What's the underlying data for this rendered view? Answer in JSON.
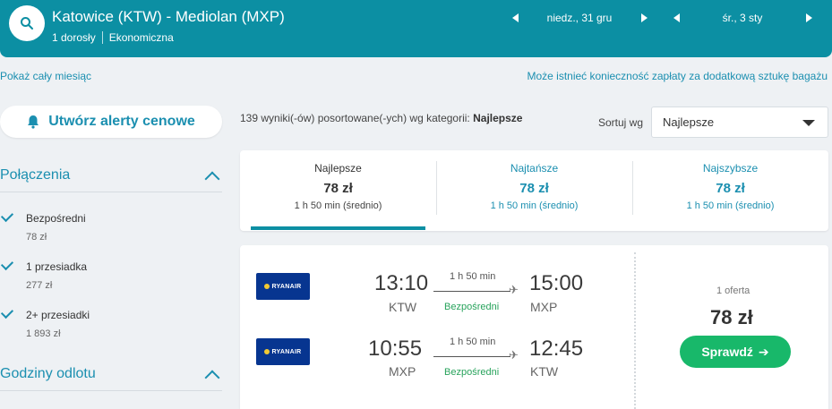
{
  "header": {
    "route": "Katowice (KTW) - Mediolan (MXP)",
    "passengers": "1 dorosły",
    "cabin": "Ekonomiczna",
    "depart_date": "niedz., 31 gru",
    "return_date": "śr., 3 sty"
  },
  "links": {
    "show_month": "Pokaż cały miesiąc",
    "baggage_notice": "Może istnieć konieczność zapłaty za dodatkową sztukę bagażu"
  },
  "sidebar": {
    "alert_button": "Utwórz alerty cenowe",
    "connections_title": "Połączenia",
    "filters": [
      {
        "label": "Bezpośredni",
        "price": "78 zł"
      },
      {
        "label": "1 przesiadka",
        "price": "277 zł"
      },
      {
        "label": "2+ przesiadki",
        "price": "1 893 zł"
      }
    ],
    "departure_title": "Godziny odlotu"
  },
  "results": {
    "count_text": "139 wyniki(-ów) posortowane(-ych) wg kategorii:",
    "count_category": "Najlepsze",
    "sort_label": "Sortuj wg",
    "sort_value": "Najlepsze"
  },
  "tabs": [
    {
      "name": "Najlepsze",
      "price": "78 zł",
      "duration": "1 h 50 min (średnio)"
    },
    {
      "name": "Najtańsze",
      "price": "78 zł",
      "duration": "1 h 50 min (średnio)"
    },
    {
      "name": "Najszybsze",
      "price": "78 zł",
      "duration": "1 h 50 min (średnio)"
    }
  ],
  "result_card": {
    "airline": "RYANAIR",
    "outbound": {
      "depart_time": "13:10",
      "depart_code": "KTW",
      "duration": "1 h 50 min",
      "stops": "Bezpośredni",
      "arrive_time": "15:00",
      "arrive_code": "MXP"
    },
    "inbound": {
      "depart_time": "10:55",
      "depart_code": "MXP",
      "duration": "1 h 50 min",
      "stops": "Bezpośredni",
      "arrive_time": "12:45",
      "arrive_code": "KTW"
    },
    "offers": "1 oferta",
    "price": "78 zł",
    "button": "Sprawdź"
  },
  "colors": {
    "header_bg": "#0c8fa3",
    "accent": "#1b8fb0",
    "green": "#18b86a",
    "direct_text": "#28a35c",
    "logo_bg": "#073590"
  },
  "icons": {
    "search": "search-icon",
    "bell": "bell-icon",
    "arrow": "arrow-right-icon",
    "plane": "plane-icon"
  }
}
